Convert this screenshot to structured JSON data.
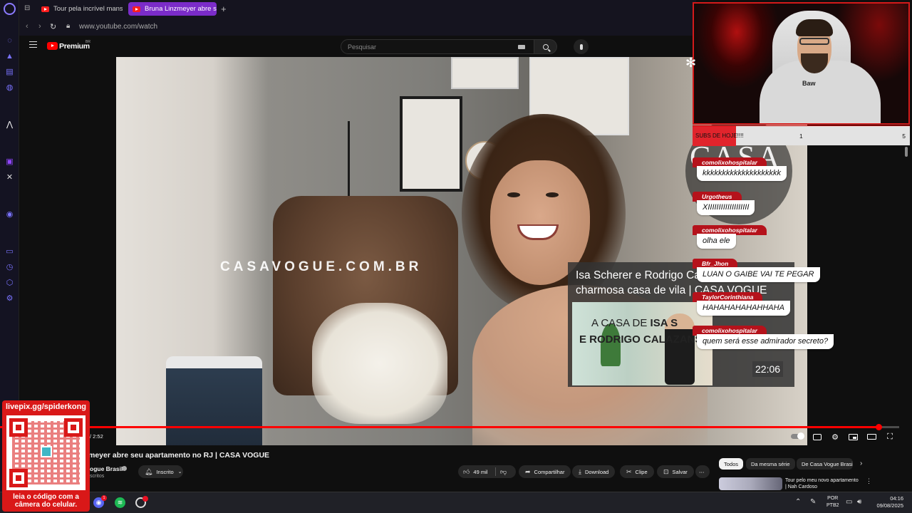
{
  "browser": {
    "tabs": [
      {
        "title": "Tour pela incrível mansão",
        "active": false
      },
      {
        "title": "Bruna Linzmeyer abre seu",
        "active": true
      }
    ],
    "url": "www.youtube.com/watch"
  },
  "youtube": {
    "brand": "Premium",
    "brand_sup": "BR",
    "search_placeholder": "Pesquisar"
  },
  "video": {
    "watermark": "CASAVOGUE.COM.BR",
    "time": "/ 2:52",
    "progress_fraction": 0.977,
    "endcard": {
      "title": "Isa Scherer e Rodrigo Calazans abrem sua charmosa casa de vila | CASA VOGUE",
      "thumb_line1_prefix": "A CASA DE ",
      "thumb_line1_bold": "ISA S",
      "thumb_line2": "E RODRIGO CALAZANS",
      "duration": "22:06"
    }
  },
  "below_video": {
    "title": "meyer abre seu apartamento no RJ | CASA VOGUE",
    "channel": "ogue Brasil",
    "subs": "scritos",
    "subscribe": "Inscrito",
    "likes": "49 mil",
    "share": "Compartilhar",
    "download": "Download",
    "clip": "Clipe",
    "save": "Salvar",
    "chips": [
      "Todos",
      "Da mesma série",
      "De Casa Vogue Brasil"
    ],
    "rec_title": "Tour pelo meu novo apartamento | Nah Cardoso"
  },
  "taskbar": {
    "lang": "POR",
    "layout": "PTB2",
    "time": "04:16",
    "date": "09/08/2025",
    "discord_badge": "1"
  },
  "stream": {
    "subs_label": "SUBS DE HOJE!!!!",
    "subs_current": "1",
    "subs_goal": "5",
    "subs_fraction": 0.2,
    "cam_shirt_text": "Baw",
    "overlay_text": "CASA",
    "chat": [
      {
        "user": "comolixohospitalar",
        "text": "kkkkkkkkkkkkkkkkkkkk"
      },
      {
        "user": "Urgotheus",
        "text": "XIIIIIIIIIIIIIIIIIII"
      },
      {
        "user": "comolixohospitalar",
        "text": "olha ele"
      },
      {
        "user": "Bfr_Jhon",
        "text": "LUAN O GAIBE VAI TE PEGAR"
      },
      {
        "user": "TaylorCorinthiana",
        "text": "HAHAHAHAHAHHAHA"
      },
      {
        "user": "comolixohospitalar",
        "text": "quem será esse admirador secreto?"
      }
    ],
    "qr_title": "livepix.gg/spiderkong",
    "qr_caption_1": "leia o código com a",
    "qr_caption_2": "câmera do celular."
  },
  "colors": {
    "opera_accent": "#7b2cc9",
    "youtube_red": "#ff0000",
    "stream_red": "#d91818"
  }
}
